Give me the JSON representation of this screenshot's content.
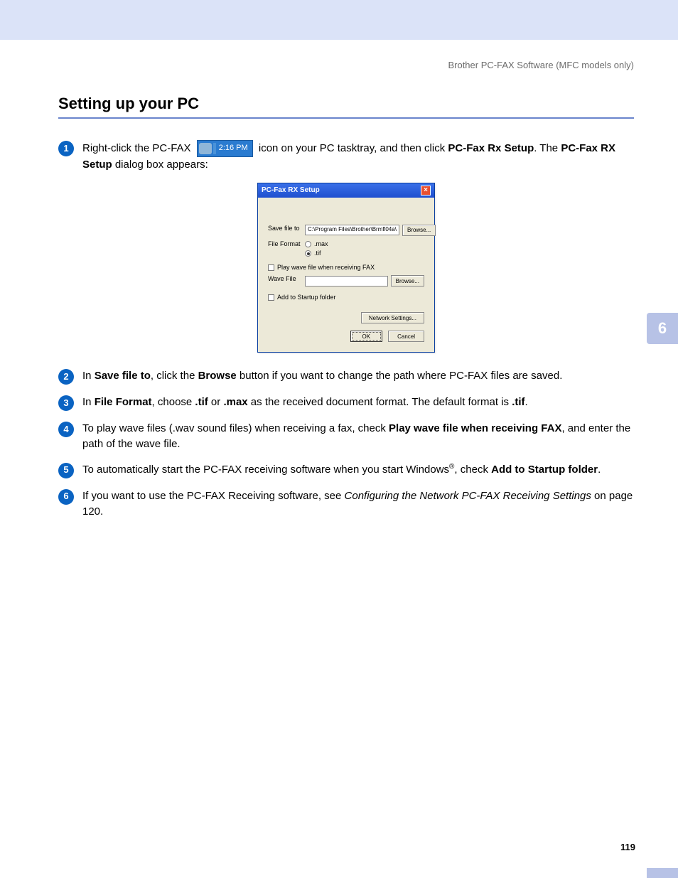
{
  "header": {
    "doc_title": "Brother PC-FAX Software (MFC models only)"
  },
  "section_title": "Setting up your PC",
  "chapter_tab": "6",
  "page_number": "119",
  "tasktray": {
    "time": "2:16 PM"
  },
  "steps": {
    "s1": {
      "a": "Right-click the PC-FAX ",
      "b": " icon on your PC tasktray, and then click ",
      "c": "PC-Fax Rx Setup",
      "d": ". The ",
      "e": "PC-Fax RX Setup",
      "f": " dialog box appears:"
    },
    "s2": {
      "a": "In ",
      "b": "Save file to",
      "c": ", click the ",
      "d": "Browse",
      "e": " button if you want to change the path where PC-FAX files are saved."
    },
    "s3": {
      "a": "In ",
      "b": "File Format",
      "c": ", choose ",
      "d": ".tif",
      "e": " or ",
      "f": ".max",
      "g": " as the received document format. The default format is ",
      "h": ".tif",
      "i": "."
    },
    "s4": {
      "a": "To play wave files (.wav sound files) when receiving a fax, check ",
      "b": "Play wave file when receiving FAX",
      "c": ", and enter the path of the wave file."
    },
    "s5": {
      "a": "To automatically start the PC-FAX receiving software when you start Windows",
      "b": "®",
      "c": ", check ",
      "d": "Add to Startup folder",
      "e": "."
    },
    "s6": {
      "a": "If you want to use the PC-FAX Receiving software, see ",
      "b": "Configuring the Network PC-FAX Receiving Settings",
      "c": " on page 120."
    }
  },
  "dialog": {
    "title": "PC-Fax RX Setup",
    "save_label": "Save file to",
    "save_path": "C:\\Program Files\\Brother\\Brmfl04a\\",
    "browse": "Browse...",
    "format_label": "File Format",
    "opt_max": ".max",
    "opt_tif": ".tif",
    "play_wave": "Play wave file when receiving FAX",
    "wave_label": "Wave File",
    "add_startup": "Add to Startup folder",
    "network": "Network Settings...",
    "ok": "OK",
    "cancel": "Cancel"
  }
}
